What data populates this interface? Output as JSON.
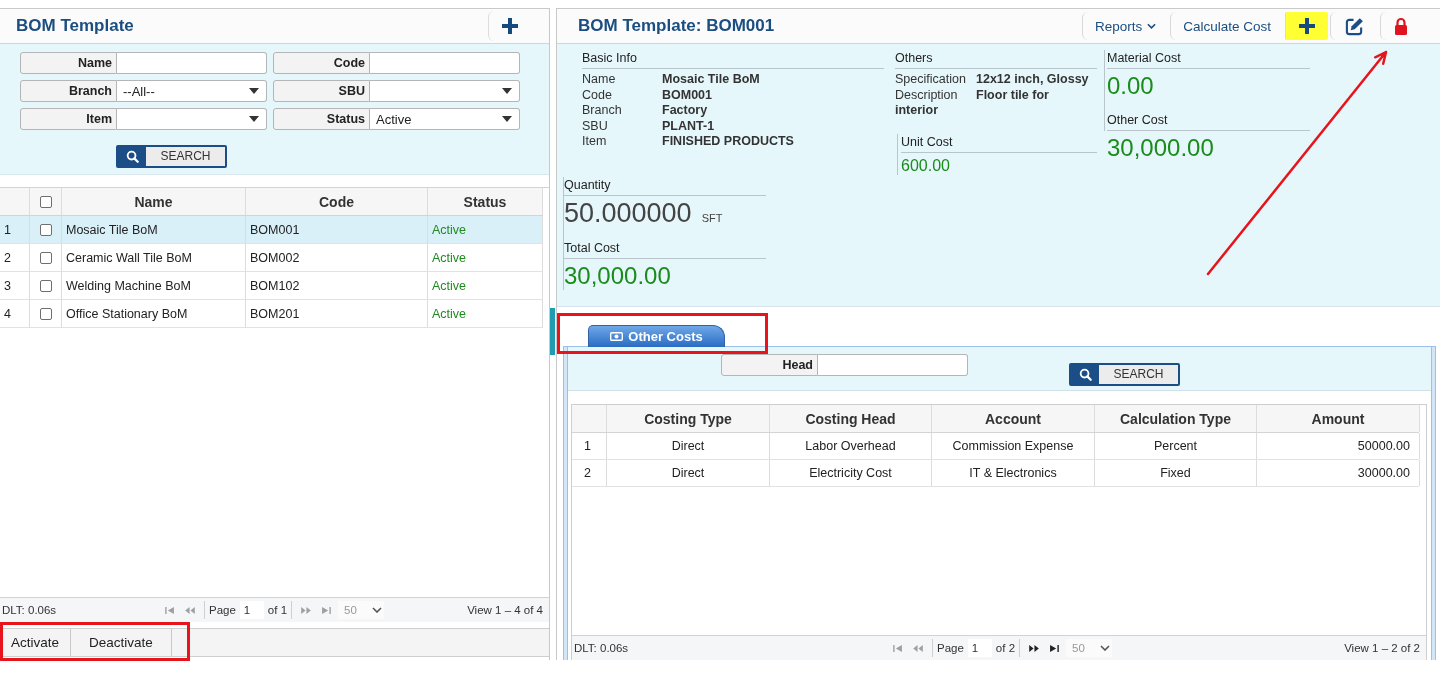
{
  "left_panel": {
    "title": "BOM Template",
    "filters": [
      {
        "label": "Name",
        "kind": "text"
      },
      {
        "label": "Code",
        "kind": "text"
      },
      {
        "label": "Branch",
        "kind": "select",
        "value": "--All--"
      },
      {
        "label": "SBU",
        "kind": "select"
      },
      {
        "label": "Item",
        "kind": "select"
      },
      {
        "label": "Status",
        "kind": "select",
        "value": "Active"
      }
    ],
    "search_button": "SEARCH",
    "table": {
      "select_all_checked": false,
      "columns": [
        "Name",
        "Code",
        "Status"
      ],
      "rows": [
        {
          "number": "1",
          "name": "Mosaic Tile BoM",
          "code": "BOM001",
          "status": "Active",
          "checked": false,
          "selected": true
        },
        {
          "number": "2",
          "name": "Ceramic Wall Tile BoM",
          "code": "BOM002",
          "status": "Active",
          "checked": false,
          "selected": false
        },
        {
          "number": "3",
          "name": "Welding Machine BoM",
          "code": "BOM102",
          "status": "Active",
          "checked": false,
          "selected": false
        },
        {
          "number": "4",
          "name": "Office Stationary BoM",
          "code": "BOM201",
          "status": "Active",
          "checked": false,
          "selected": false
        }
      ]
    },
    "pager": {
      "timing": "DLT: 0.06s",
      "page_label": "Page",
      "page": "1",
      "total": "of 1",
      "page_size": "50",
      "summary": "View 1 – 4 of 4",
      "nav": [
        {
          "kind": "first",
          "disabled": true
        },
        {
          "kind": "prev",
          "disabled": true
        },
        {
          "kind": "next",
          "disabled": true
        },
        {
          "kind": "last",
          "disabled": true
        }
      ]
    },
    "actions": {
      "highlighted": true,
      "buttons": [
        "Activate",
        "Deactivate"
      ]
    }
  },
  "right_panel": {
    "title": "BOM Template: BOM001",
    "toolbar": [
      {
        "kind": "menu",
        "label": "Reports",
        "hovered": false
      },
      {
        "kind": "text",
        "label": "Calculate Cost",
        "hovered": false
      },
      {
        "kind": "add",
        "hovered": true
      },
      {
        "kind": "edit",
        "hovered": false
      },
      {
        "kind": "lock",
        "hovered": false,
        "pointed_at": true
      }
    ],
    "info": {
      "basic": {
        "title": "Basic Info",
        "fields": [
          {
            "label": "Name",
            "value": "Mosaic Tile BoM"
          },
          {
            "label": "Code",
            "value": "BOM001"
          },
          {
            "label": "Branch",
            "value": "Factory"
          },
          {
            "label": "SBU",
            "value": "PLANT-1"
          },
          {
            "label": "Item",
            "value": "FINISHED PRODUCTS"
          }
        ]
      },
      "others": {
        "title": "Others",
        "fields": [
          {
            "label": "Specification",
            "value": "12x12 inch, Glossy"
          },
          {
            "label": "Description",
            "value": "Floor tile for interior"
          }
        ]
      },
      "unit_cost": {
        "label": "Unit Cost",
        "value": "600.00"
      },
      "material_cost": {
        "label": "Material Cost",
        "value": "0.00"
      },
      "other_cost": {
        "label": "Other Cost",
        "value": "30,000.00"
      },
      "quantity": {
        "label": "Quantity",
        "value": "50.000000",
        "unit": "SFT"
      },
      "total_cost": {
        "label": "Total Cost",
        "value": "30,000.00"
      }
    },
    "tabs": [
      {
        "label": "Other Costs",
        "selected": true,
        "highlighted": true
      }
    ],
    "costs": {
      "filter": {
        "label": "Head"
      },
      "search_button": "SEARCH",
      "table": {
        "columns": [
          "Costing Type",
          "Costing Head",
          "Account",
          "Calculation Type",
          "Amount"
        ],
        "rows": [
          {
            "number": "1",
            "cells": [
              "Direct",
              "Labor Overhead",
              "Commission Expense",
              "Percent",
              "50000.00"
            ]
          },
          {
            "number": "2",
            "cells": [
              "Direct",
              "Electricity Cost",
              "IT & Electronics",
              "Fixed",
              "30000.00"
            ]
          }
        ]
      },
      "pager": {
        "timing": "DLT: 0.06s",
        "page_label": "Page",
        "page": "1",
        "total": "of 2",
        "page_size": "50",
        "summary": "View 1 – 2 of 2",
        "nav": [
          {
            "kind": "first",
            "disabled": true
          },
          {
            "kind": "prev",
            "disabled": true
          },
          {
            "kind": "next",
            "disabled": false
          },
          {
            "kind": "last",
            "disabled": false
          }
        ]
      }
    }
  }
}
